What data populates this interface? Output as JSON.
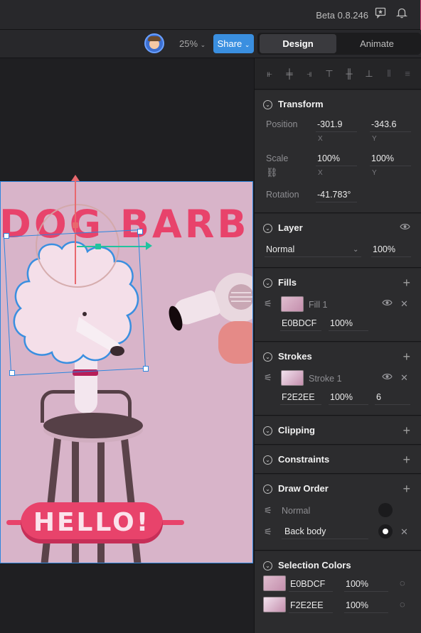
{
  "topbar": {
    "version": "Beta 0.8.246",
    "icons": [
      "feedback-icon",
      "bell-icon"
    ]
  },
  "toolbar": {
    "zoom": "25%",
    "share_label": "Share",
    "tabs": [
      {
        "label": "Design",
        "active": true
      },
      {
        "label": "Animate",
        "active": false
      }
    ]
  },
  "canvas": {
    "title_text": "DOG BARBI",
    "hello_text": "HELLO!"
  },
  "inspector": {
    "transform": {
      "title": "Transform",
      "position_label": "Position",
      "position_x": "-301.9",
      "position_y": "-343.6",
      "scale_label": "Scale",
      "scale_x": "100%",
      "scale_y": "100%",
      "rotation_label": "Rotation",
      "rotation": "-41.783°",
      "x_label": "X",
      "y_label": "Y"
    },
    "layer": {
      "title": "Layer",
      "blend": "Normal",
      "opacity": "100%"
    },
    "fills": {
      "title": "Fills",
      "name": "Fill 1",
      "hex": "E0BDCF",
      "opacity": "100%",
      "color": "#E0BDCF"
    },
    "strokes": {
      "title": "Strokes",
      "name": "Stroke 1",
      "hex": "F2E2EE",
      "opacity": "100%",
      "width": "6",
      "color": "#F2E2EE"
    },
    "clipping": {
      "title": "Clipping"
    },
    "constraints": {
      "title": "Constraints"
    },
    "draw_order": {
      "title": "Draw Order",
      "rows": [
        {
          "label": "Normal",
          "selected": false
        },
        {
          "label": "Back body",
          "selected": true
        }
      ]
    },
    "selection_colors": {
      "title": "Selection Colors",
      "colors": [
        {
          "hex": "E0BDCF",
          "opacity": "100%",
          "color": "#E0BDCF"
        },
        {
          "hex": "F2E2EE",
          "opacity": "100%",
          "color": "#F2E2EE"
        }
      ]
    }
  }
}
